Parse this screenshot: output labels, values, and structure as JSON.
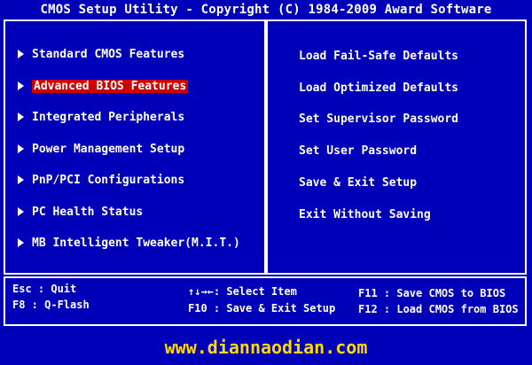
{
  "header": {
    "title": "CMOS Setup Utility - Copyright (C) 1984-2009 Award Software"
  },
  "left_menu": [
    {
      "label": "Standard CMOS Features"
    },
    {
      "label": "Advanced BIOS Features"
    },
    {
      "label": "Integrated Peripherals"
    },
    {
      "label": "Power Management Setup"
    },
    {
      "label": "PnP/PCI Configurations"
    },
    {
      "label": "PC Health Status"
    },
    {
      "label": "MB Intelligent Tweaker(M.I.T.)"
    }
  ],
  "selected_item": "Advanced BIOS Features",
  "right_menu": [
    {
      "label": "Load Fail-Safe Defaults"
    },
    {
      "label": "Load Optimized Defaults"
    },
    {
      "label": "Set Supervisor Password"
    },
    {
      "label": "Set User Password"
    },
    {
      "label": "Save & Exit Setup"
    },
    {
      "label": "Exit Without Saving"
    }
  ],
  "help": {
    "esc": "Esc : Quit",
    "f8": "F8  : Q-Flash",
    "select": "↑↓→←: Select Item",
    "f10": "F10 : Save & Exit Setup",
    "f11": "F11 : Save CMOS to BIOS",
    "f12": "F12 : Load CMOS from BIOS"
  },
  "watermark": "www.diannaodian.com",
  "colors": {
    "background": "#0000b8",
    "highlight": "#cc0000",
    "text": "#ffffff",
    "watermark": "#ffd800"
  }
}
